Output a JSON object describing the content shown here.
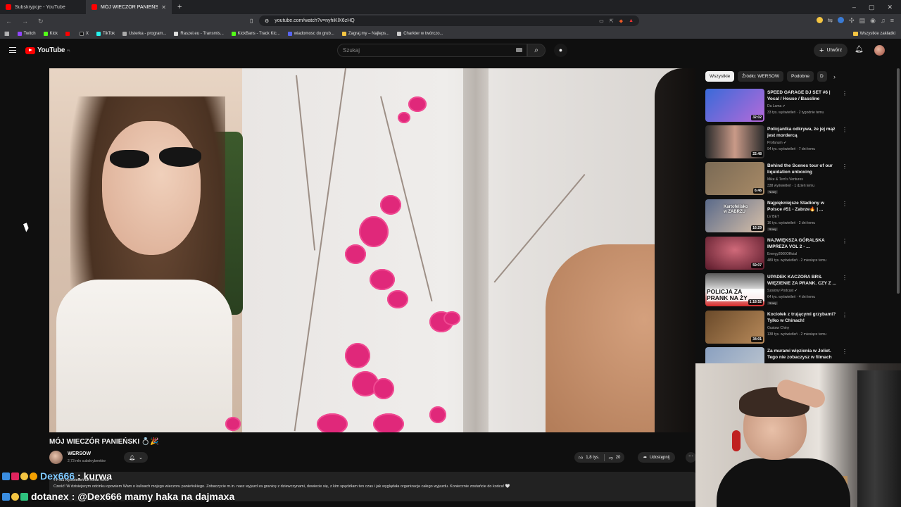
{
  "browser": {
    "tabs": [
      {
        "title": "Subskrypcje - YouTube",
        "active": false
      },
      {
        "title": "MÓJ WIECZÓR PANIEŃSKI 💍",
        "active": true
      }
    ],
    "new_tab": "+",
    "url": "youtube.com/watch?v=nyhiKlX6zHQ",
    "bookmarks": [
      "Twitch",
      "Kick",
      "",
      "X",
      "TikTok",
      "Usterka - program...",
      "Raszei.eu - Transmis...",
      "KickBans - Track Kic...",
      "wiadomosc do grub...",
      "Zagraj.my – Najleps...",
      "Charkter w twórczo..."
    ],
    "bookmarks_right": "Wszystkie zakładki"
  },
  "youtube": {
    "logo_text": "YouTube",
    "logo_region": "PL",
    "search_placeholder": "Szukaj",
    "create_label": "Utwórz"
  },
  "video": {
    "title": "MÓJ WIECZÓR PANIEŃSKI 💍🎉",
    "channel": "WERSOW",
    "subscribers": "2,73 mln subskrybentów",
    "likes": "1,8 tys.",
    "dislikes": "20",
    "share": "Udostępnij",
    "desc_meta": "74 463 wyświetleń  29 minut temu",
    "description": "Cześć! W dzisiejszym odcinku opowiem Wam o kulisach mojego wieczoru panieńskiego. Zobaczycie m.in. nasz wyjazd za granicę z dziewczynami, dowiecie się, z kim spędziłam ten czas i jak wyglądała organizacja całego wyjazdu. Koniecznie zostańcie do końca! 🤍"
  },
  "chips": [
    "Wszystkie",
    "Źródło: WERSOW",
    "Podobne",
    "D"
  ],
  "recommendations": [
    {
      "title": "SPEED GARAGE DJ SET #6 | Vocal / House / Bassline",
      "channel": "Da Lama ✔",
      "views": "33 tys. wyświetleń · 2 tygodnie temu",
      "duration": "32:02",
      "badge": "",
      "color1": "#3a6ad9",
      "color2": "#b56ad9"
    },
    {
      "title": "Policjantka odkrywa, że jej mąż jest mordercą",
      "channel": "Profanum ✔",
      "views": "94 tys. wyświetleń · 7 dni temu",
      "duration": "22:48",
      "badge": "",
      "color1": "#2a2a2a",
      "color2": "#c99a88"
    },
    {
      "title": "Behind the Scenes tour of our liquidation unboxing operation...",
      "channel": "Mike & Terri's Ventures",
      "views": "338 wyświetleń · 1 dzień temu",
      "duration": "6:46",
      "badge": "Nowy",
      "color1": "#7a6a55",
      "color2": "#a88a66"
    },
    {
      "title": "Najpiękniejsze Stadiony w Polsce #51 - Zabrze🔥 | ...",
      "channel": "LV BET",
      "views": "16 tys. wyświetleń · 2 dni temu",
      "duration": "16:29",
      "badge": "Nowy",
      "color1": "#5a6a8a",
      "color2": "#d8c0a8"
    },
    {
      "title": "NAJWIĘKSZA GÓRALSKA IMPREZA VOL 2 - ...",
      "channel": "Energy2000Official",
      "views": "489 tys. wyświetleń · 2 miesiące temu",
      "duration": "59:07",
      "badge": "",
      "color1": "#5a1a2a",
      "color2": "#d06a7a"
    },
    {
      "title": "UPADEK KACZORA BRS. WIĘZIENIE ZA PRANK. CZY Z ...",
      "channel": "Szalony Podcast ✔",
      "views": "64 tys. wyświetleń · 4 dni temu",
      "duration": "1:18:52",
      "badge": "Nowy",
      "color1": "#e8e8e8",
      "color2": "#d82a2a"
    },
    {
      "title": "Kociołek z trującymi grzybami? Tylko w Chinach!",
      "channel": "Gustaw Chiny",
      "views": "138 tys. wyświetleń · 2 miesiące temu",
      "duration": "34:01",
      "badge": "",
      "color1": "#6a4a2a",
      "color2": "#b88a5a"
    },
    {
      "title": "Za murami więzienia w Joliet. Tego nie zobaczysz w filmach",
      "channel": "",
      "views": "",
      "duration": "",
      "badge": "",
      "color1": "#8aa0c0",
      "color2": "#c0c8d0"
    }
  ],
  "recommendation_extras": {
    "thumb3_text": "Kartofelisko w ZABRZU",
    "thumb6_text": "POLICJA ZA PRANK NA ŻY"
  },
  "chat": [
    {
      "user": "Dex666",
      "message": ": kurwa",
      "user_color": "#7ec8ff"
    },
    {
      "user": "dotanex",
      "message": ": @Dex666 mamy haka na dajmaxa",
      "user_color": "#ffffff"
    }
  ]
}
